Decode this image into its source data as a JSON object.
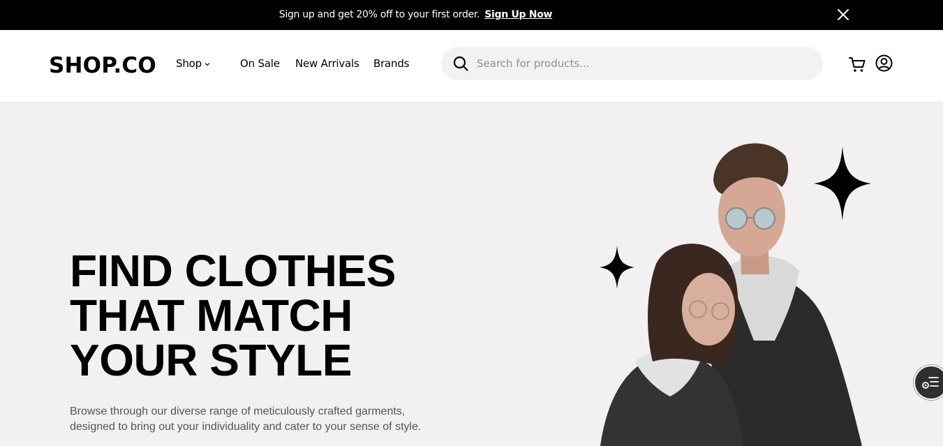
{
  "promo": {
    "message": "Sign up and get 20% off to your first order.",
    "link_label": "Sign Up Now",
    "close_icon": "close-icon"
  },
  "header": {
    "logo": "SHOP.CO",
    "nav": {
      "shop": "Shop",
      "on_sale": "On Sale",
      "new_arrivals": "New Arrivals",
      "brands": "Brands"
    },
    "search": {
      "placeholder": "Search for products...",
      "value": "",
      "icon": "search-icon"
    },
    "icons": [
      "cart-icon",
      "user-icon"
    ]
  },
  "hero": {
    "title_lines": [
      "FIND CLOTHES",
      "THAT MATCH",
      "YOUR STYLE"
    ],
    "subtitle_lines": [
      "Browse through our diverse range of meticulously crafted garments,",
      "designed to bring out your individuality and cater to your sense of style."
    ]
  },
  "colors": {
    "promo_bg": "#000000",
    "hero_bg": "#f2f0f1",
    "search_bg": "#f2f2f2",
    "text_primary": "#000000",
    "text_secondary": "#555555"
  }
}
